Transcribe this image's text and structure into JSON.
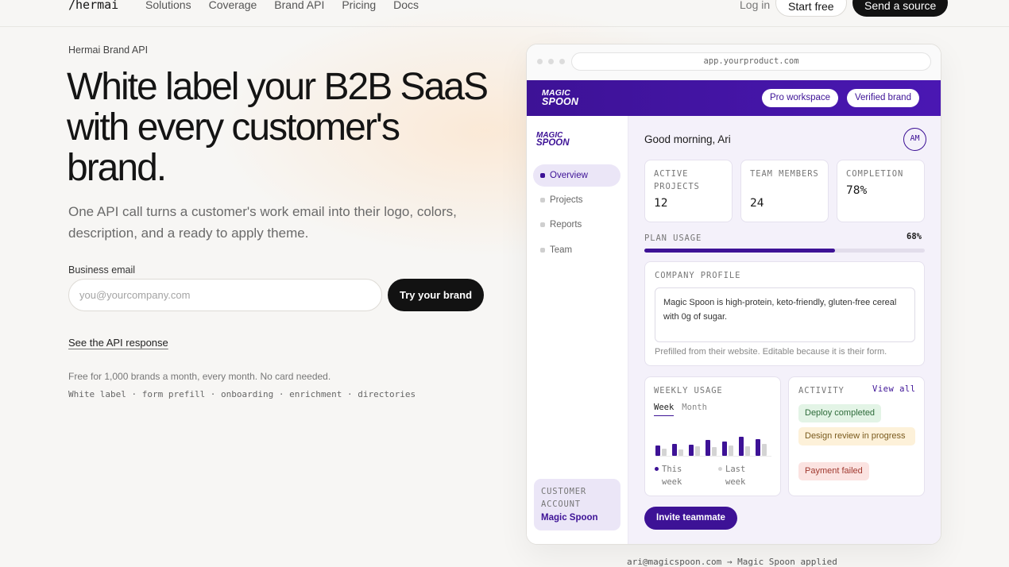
{
  "nav": {
    "logo": "/hermai",
    "links": [
      "Solutions",
      "Coverage",
      "Brand API",
      "Pricing",
      "Docs"
    ],
    "login": "Log in",
    "start_free": "Start free",
    "send_source": "Send a source"
  },
  "hero": {
    "eyebrow": "Hermai Brand API",
    "headline": "White label your B2B SaaS with every customer's brand.",
    "subhead": "One API call turns a customer's work email into their logo, colors, description, and a ready to apply theme.",
    "email_label": "Business email",
    "email_placeholder": "you@yourcompany.com",
    "email_value": "",
    "try_button": "Try your brand",
    "api_link": "See the API response",
    "free_note": "Free for 1,000 brands a month, every month. No card needed.",
    "tags": "White label · form prefill · onboarding · enrichment · directories"
  },
  "mock": {
    "url": "app.yourproduct.com",
    "brand_line1": "MAGIC",
    "brand_line2": "SPOON",
    "pill_workspace": "Pro workspace",
    "pill_verified": "Verified brand",
    "sidebar_items": [
      "Overview",
      "Projects",
      "Reports",
      "Team"
    ],
    "active_item": "Overview",
    "account_label": "CUSTOMER ACCOUNT",
    "account_value": "Magic Spoon",
    "greeting": "Good morning, Ari",
    "avatar": "AM",
    "stats": [
      {
        "label": "ACTIVE PROJECTS",
        "value": "12"
      },
      {
        "label": "TEAM MEMBERS",
        "value": "24"
      },
      {
        "label": "COMPLETION",
        "value": "78%"
      }
    ],
    "plan_usage_label": "PLAN USAGE",
    "plan_usage_pct": "68%",
    "plan_usage_value": 0.68,
    "profile_label": "COMPANY PROFILE",
    "profile_text": "Magic Spoon is high-protein, keto-friendly, gluten-free cereal with 0g of sugar.",
    "profile_note": "Prefilled from their website. Editable because it is their form.",
    "weekly_label": "WEEKLY USAGE",
    "tab_week": "Week",
    "tab_month": "Month",
    "weekly_this": [
      0.45,
      0.55,
      0.5,
      0.7,
      0.65,
      0.85,
      0.75
    ],
    "weekly_last": [
      0.32,
      0.3,
      0.42,
      0.38,
      0.48,
      0.42,
      0.55
    ],
    "legend_this": "This week",
    "legend_last": "Last week",
    "activity_label": "ACTIVITY",
    "view_all": "View all",
    "activity": [
      "Deploy completed",
      "Design review in progress",
      "Payment failed"
    ],
    "invite_button": "Invite teammate"
  },
  "footnote": "ari@magicspoon.com → Magic Spoon applied",
  "colors": {
    "brand": "#3d1296",
    "accent_bg": "#ebe6f7",
    "dark": "#121212"
  }
}
